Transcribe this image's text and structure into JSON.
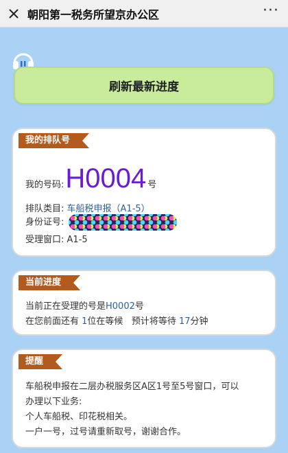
{
  "topbar": {
    "title": "朝阳第一税务所望京办公区",
    "close_icon": "close-icon",
    "more_label": "···"
  },
  "refresh_button": {
    "label": "刷新最新进度"
  },
  "my_queue": {
    "tag": "我的排队号",
    "number_label": "我的号码:",
    "number": "H0004",
    "number_suffix": "号",
    "category_label": "排队类目:",
    "category_value": "车船税申报（A1-5）",
    "id_label": "身份证号:",
    "window_label": "受理窗口:",
    "window_value": "A1-5"
  },
  "progress": {
    "tag": "当前进度",
    "current_prefix": "当前正在受理的号是",
    "current_number": "H0002",
    "current_suffix": "号",
    "ahead_prefix": "在您前面还有 ",
    "ahead_count": "1",
    "ahead_middle": "位在等候   预计将等待 ",
    "wait_minutes": "17",
    "wait_suffix": "分钟"
  },
  "reminder": {
    "tag": "提醒",
    "lines": [
      "车船税申报在二层办税服务区A区1号至5号窗口，可以",
      "办理以下业务:",
      "个人车船税、印花税相关。",
      "一户一号，过号请重新取号，谢谢合作。"
    ]
  },
  "colors": {
    "background": "#a9d2f5",
    "refresh_button": "#c9ec9c",
    "tag": "#b35a1f",
    "highlight": "#2b5f9a",
    "number": "#6a1bd6"
  }
}
